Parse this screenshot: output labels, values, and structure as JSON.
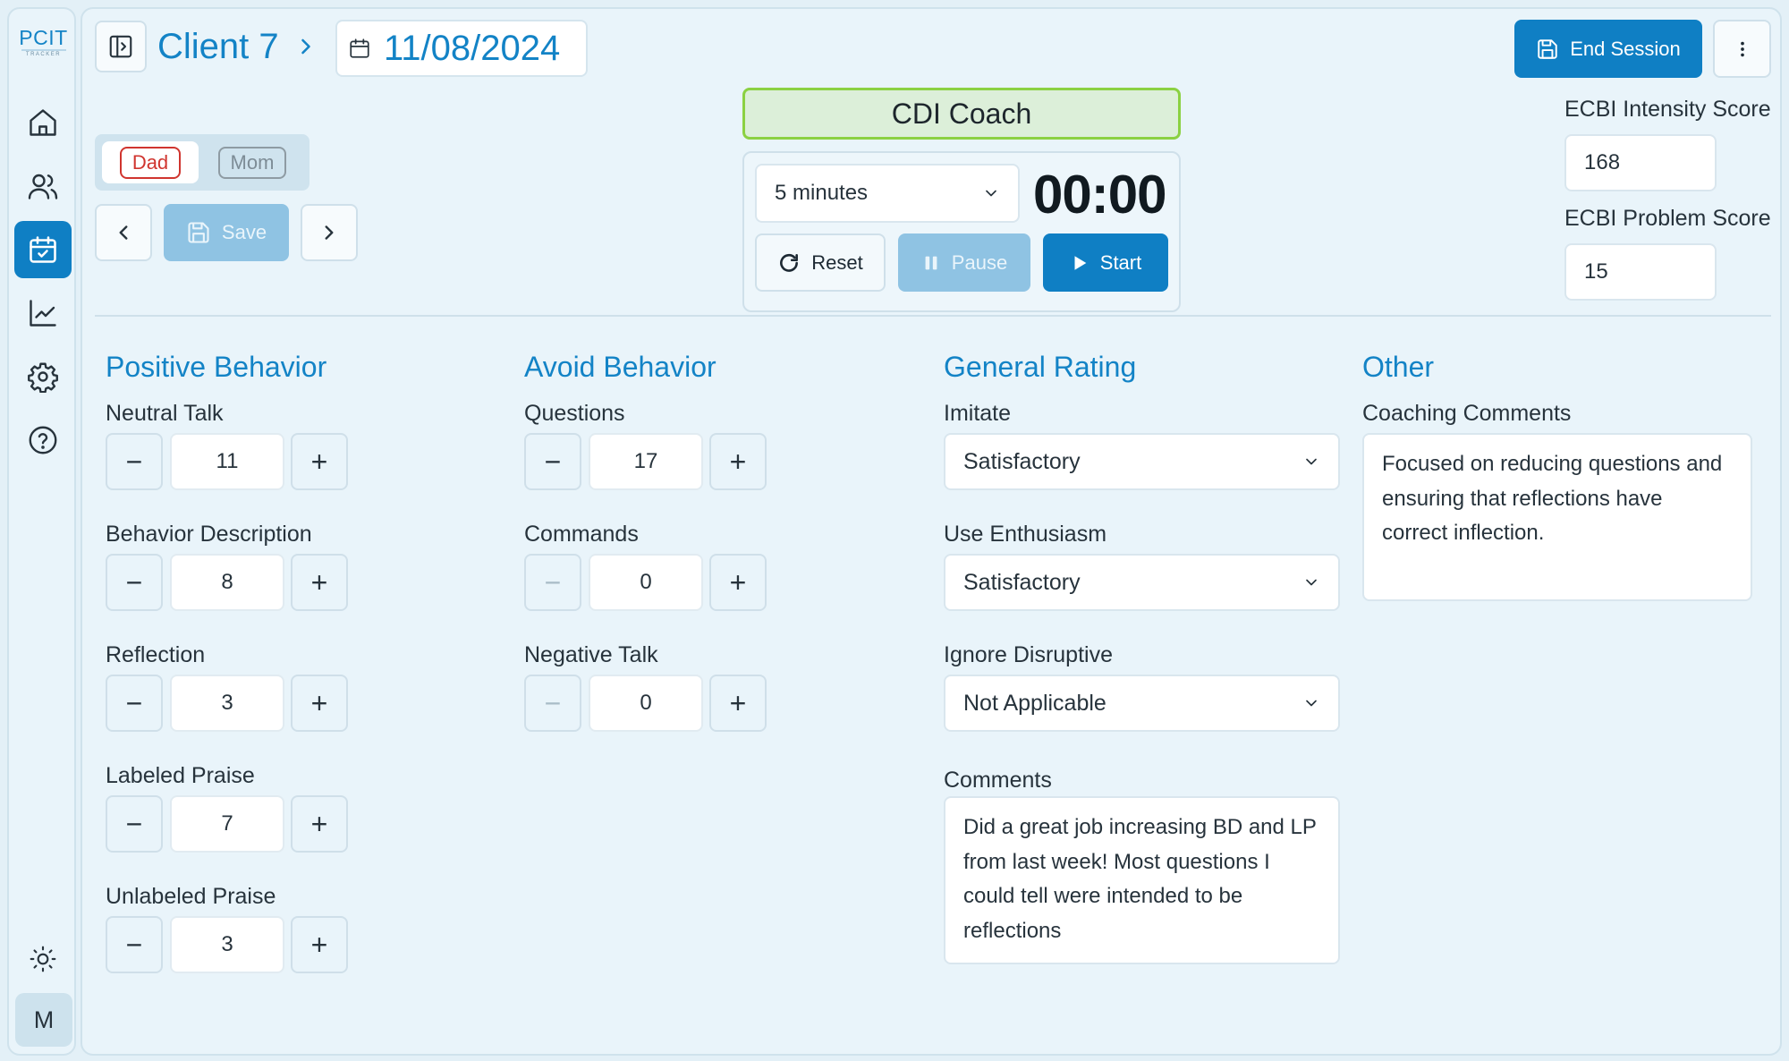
{
  "app": {
    "logo_text": "PCIT",
    "logo_subtext": "TRACKER"
  },
  "sidebar": {
    "items": [
      {
        "name": "home",
        "icon": "home-icon"
      },
      {
        "name": "clients",
        "icon": "users-icon"
      },
      {
        "name": "sessions",
        "icon": "calendar-check-icon",
        "active": true
      },
      {
        "name": "progress",
        "icon": "chart-line-icon"
      },
      {
        "name": "settings",
        "icon": "gear-icon"
      },
      {
        "name": "help",
        "icon": "help-circle-icon"
      }
    ],
    "theme_icon": "sun-icon",
    "avatar_initial": "M"
  },
  "header": {
    "client_name": "Client 7",
    "session_date": "11/08/2024",
    "end_session_label": "End Session"
  },
  "caregiver_tabs": [
    {
      "label": "Dad",
      "active": true,
      "color": "#d0352f"
    },
    {
      "label": "Mom",
      "active": false,
      "color": "#7d8c96"
    }
  ],
  "nav": {
    "save_label": "Save"
  },
  "session": {
    "mode": "CDI Coach",
    "duration": "5 minutes",
    "timer": "00:00",
    "reset_label": "Reset",
    "pause_label": "Pause",
    "start_label": "Start"
  },
  "ecbi": {
    "intensity_label": "ECBI Intensity Score",
    "intensity_value": "168",
    "problem_label": "ECBI Problem Score",
    "problem_value": "15"
  },
  "positive": {
    "title": "Positive Behavior",
    "items": [
      {
        "label": "Neutral Talk",
        "value": "11"
      },
      {
        "label": "Behavior Description",
        "value": "8"
      },
      {
        "label": "Reflection",
        "value": "3"
      },
      {
        "label": "Labeled Praise",
        "value": "7"
      },
      {
        "label": "Unlabeled Praise",
        "value": "3"
      }
    ]
  },
  "avoid": {
    "title": "Avoid Behavior",
    "items": [
      {
        "label": "Questions",
        "value": "17"
      },
      {
        "label": "Commands",
        "value": "0"
      },
      {
        "label": "Negative Talk",
        "value": "0"
      }
    ]
  },
  "general": {
    "title": "General Rating",
    "items": [
      {
        "label": "Imitate",
        "value": "Satisfactory"
      },
      {
        "label": "Use Enthusiasm",
        "value": "Satisfactory"
      },
      {
        "label": "Ignore Disruptive",
        "value": "Not Applicable"
      }
    ],
    "comments_label": "Comments",
    "comments_text": "Did a great job increasing BD and LP from last week! Most questions I could tell were intended to be reflections"
  },
  "other": {
    "title": "Other",
    "coaching_label": "Coaching Comments",
    "coaching_text": "Focused on reducing questions and ensuring that reflections have correct inflection."
  },
  "colors": {
    "accent": "#1383c6",
    "primary_button": "#0f7fc4",
    "disabled_button": "#8fc3e3",
    "mode_bg": "#dcefd9",
    "mode_border": "#8bd142",
    "background": "#e9f4fa"
  }
}
